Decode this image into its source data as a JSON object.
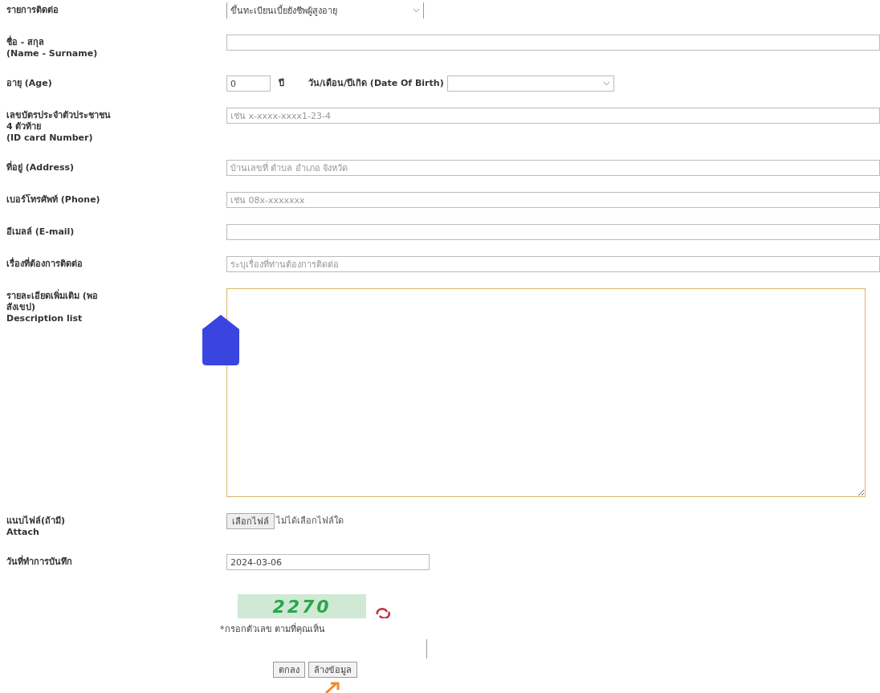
{
  "form": {
    "rows": [
      {
        "kind": "select",
        "label": [
          "รายการติดต่อ"
        ],
        "value": "ขึ้นทะเบียนเบี้ยยังชีพผู้สูงอายุ"
      },
      {
        "kind": "text",
        "label": [
          "ชื่อ - สกุล",
          "(Name - Surname)"
        ]
      },
      {
        "kind": "age",
        "label": [
          "อายุ (Age)"
        ],
        "value": "0",
        "unit": "ปี",
        "dob_label": "วัน/เดือน/ปีเกิด (Date Of Birth)"
      },
      {
        "kind": "text",
        "label": [
          "เลขบัตรประจำตัวประชาชน",
          "4 ตัวท้าย",
          "(ID card Number)"
        ],
        "placeholder": "เช่น x-xxxx-xxxx1-23-4"
      },
      {
        "kind": "text",
        "label": [
          "ที่อยู่ (Address)"
        ],
        "placeholder": "บ้านเลขที่ ตำบล อำเภอ จังหวัด"
      },
      {
        "kind": "text",
        "label": [
          "เบอร์โทรศัพท์ (Phone)"
        ],
        "placeholder": "เช่น 08x-xxxxxxx"
      },
      {
        "kind": "text",
        "label": [
          "อีเมลล์ (E-mail)"
        ]
      },
      {
        "kind": "text",
        "label": [
          "เรื่องที่ต้องการติดต่อ"
        ],
        "placeholder": "ระบุเรื่องที่ท่านต้องการติดต่อ"
      },
      {
        "kind": "textarea",
        "label": [
          "รายละเอียดเพิ่มเติม (พอ",
          "สังเขป)",
          "Description list"
        ]
      },
      {
        "kind": "file",
        "label": [
          "แนบไฟล์(ถ้ามี)",
          "Attach"
        ],
        "button": "เลือกไฟล์",
        "status": "ไม่ได้เลือกไฟล์ใด"
      },
      {
        "kind": "date",
        "label": [
          "วันที่ทำการบันทึก"
        ],
        "value": "2024-03-06"
      }
    ]
  },
  "captcha": {
    "code": "2270",
    "hint": "*กรอกตัวเลข ตามที่คุณเห็น"
  },
  "buttons": [
    "ตกลง",
    "ล้างข้อมูล"
  ]
}
